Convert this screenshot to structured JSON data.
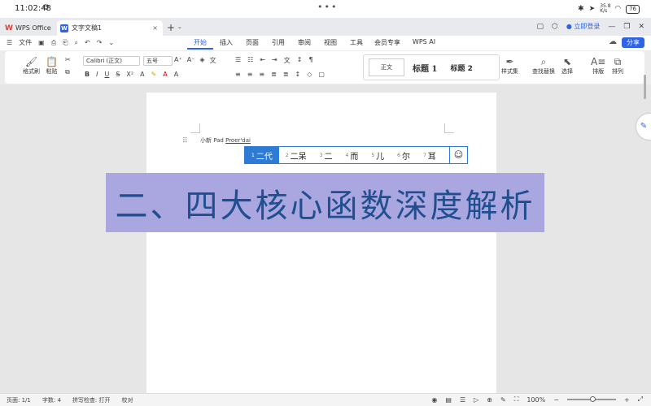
{
  "status": {
    "time": "11:02:48",
    "gear": "⚙",
    "dots": "•••",
    "net": "35.8 K/s",
    "battery": "76"
  },
  "tabs": {
    "wps_label": "WPS Office",
    "doc_label": "文字文稿1",
    "close": "×",
    "add": "+",
    "more": "⌄",
    "login": "立即登录"
  },
  "menu": {
    "file": "文件",
    "tabs": [
      "开始",
      "插入",
      "页面",
      "引用",
      "审阅",
      "视图",
      "工具",
      "会员专享"
    ],
    "ai": "WPS AI",
    "share": "分享"
  },
  "ribbon": {
    "format_painter": "格式刷",
    "paste": "粘贴",
    "font": "Calibri (正文)",
    "size": "五号",
    "style_normal": "正文",
    "style_h1": "标题 1",
    "style_h2": "标题 2",
    "style_set": "样式集",
    "find_replace": "查找替换",
    "select": "选择",
    "typeset": "排版",
    "arrange": "排列"
  },
  "document": {
    "ime_prefix": "小新 Pad ",
    "ime_pinyin": "Proer'dai",
    "heading": "二、四大核心函数深度解析"
  },
  "candidates": [
    {
      "num": "1",
      "text": "二代"
    },
    {
      "num": "2",
      "text": "二呆"
    },
    {
      "num": "3",
      "text": "二"
    },
    {
      "num": "4",
      "text": "而"
    },
    {
      "num": "5",
      "text": "儿"
    },
    {
      "num": "6",
      "text": "尔"
    },
    {
      "num": "7",
      "text": "耳"
    }
  ],
  "bottom": {
    "page": "页面: 1/1",
    "words": "字数: 4",
    "spell": "拼写检查: 打开",
    "proof": "校对",
    "zoom": "100%"
  },
  "colors": {
    "accent": "#2e63e6",
    "banner_bg": "#a9a6e0",
    "heading_text": "#1f4f8f"
  }
}
